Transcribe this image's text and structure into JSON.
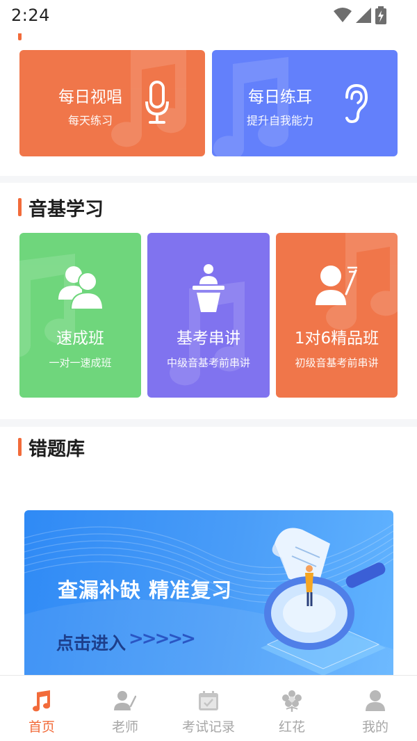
{
  "status_bar": {
    "time": "2:24",
    "icons": [
      "wifi-icon",
      "signal-icon",
      "battery-charging-icon"
    ]
  },
  "sections": {
    "top": {
      "cards": [
        {
          "title": "每日视唱",
          "subtitle": "每天练习",
          "icon": "microphone-icon",
          "color": "#f0764a"
        },
        {
          "title": "每日练耳",
          "subtitle": "提升自我能力",
          "icon": "ear-icon",
          "color": "#6380fb"
        }
      ]
    },
    "basics": {
      "title": "音基学习",
      "cards": [
        {
          "title": "速成班",
          "subtitle": "一对一速成班",
          "icon": "group-users-icon",
          "color": "#6fd67c"
        },
        {
          "title": "基考串讲",
          "subtitle": "中级音基考前串讲",
          "icon": "lecturer-podium-icon",
          "color": "#8073ef"
        },
        {
          "title": "1对6精品班",
          "subtitle": "初级音基考前串讲",
          "icon": "teacher-icon",
          "color": "#f0764a"
        }
      ]
    },
    "mistakes": {
      "title": "错题库",
      "banner": {
        "title": "查漏补缺 精准复习",
        "cta": "点击进入",
        "arrows": ">>>>>"
      }
    }
  },
  "bottom_nav": {
    "items": [
      {
        "label": "首页",
        "icon": "music-note-icon",
        "active": true
      },
      {
        "label": "老师",
        "icon": "teacher-icon",
        "active": false
      },
      {
        "label": "考试记录",
        "icon": "calendar-check-icon",
        "active": false
      },
      {
        "label": "红花",
        "icon": "flower-icon",
        "active": false
      },
      {
        "label": "我的",
        "icon": "user-icon",
        "active": false
      }
    ]
  },
  "colors": {
    "accent": "#f26b3a",
    "inactive": "#a7a7a7"
  }
}
